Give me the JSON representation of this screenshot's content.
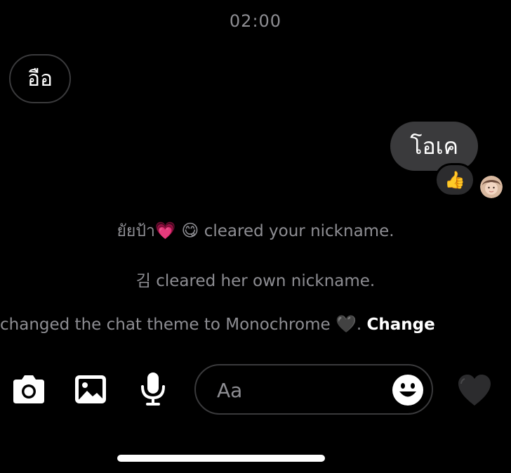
{
  "timestamp": "02:00",
  "messages": {
    "incoming": {
      "text": "อือ"
    },
    "outgoing": {
      "text": "โอเค",
      "reaction": "👍"
    }
  },
  "system_events": {
    "event1": {
      "name": "ยัยป้า",
      "emoji": "💗 😋",
      "text": "cleared your nickname."
    },
    "event2": {
      "text": "김 cleared her own nickname."
    },
    "event3": {
      "text": "changed the chat theme to Monochrome",
      "emoji": "🖤",
      "separator": ".",
      "action": "Change"
    }
  },
  "composer": {
    "placeholder": "Aa",
    "value": "",
    "like_emoji": "🖤"
  },
  "icons": {
    "camera": "camera-icon",
    "gallery": "image-icon",
    "mic": "microphone-icon",
    "emoji": "smiley-icon"
  },
  "colors": {
    "background": "#000000",
    "bubble_outgoing": "#3a3a3c",
    "bubble_border": "#3a3a3c",
    "muted_text": "#8e8e93",
    "text": "#ffffff"
  }
}
